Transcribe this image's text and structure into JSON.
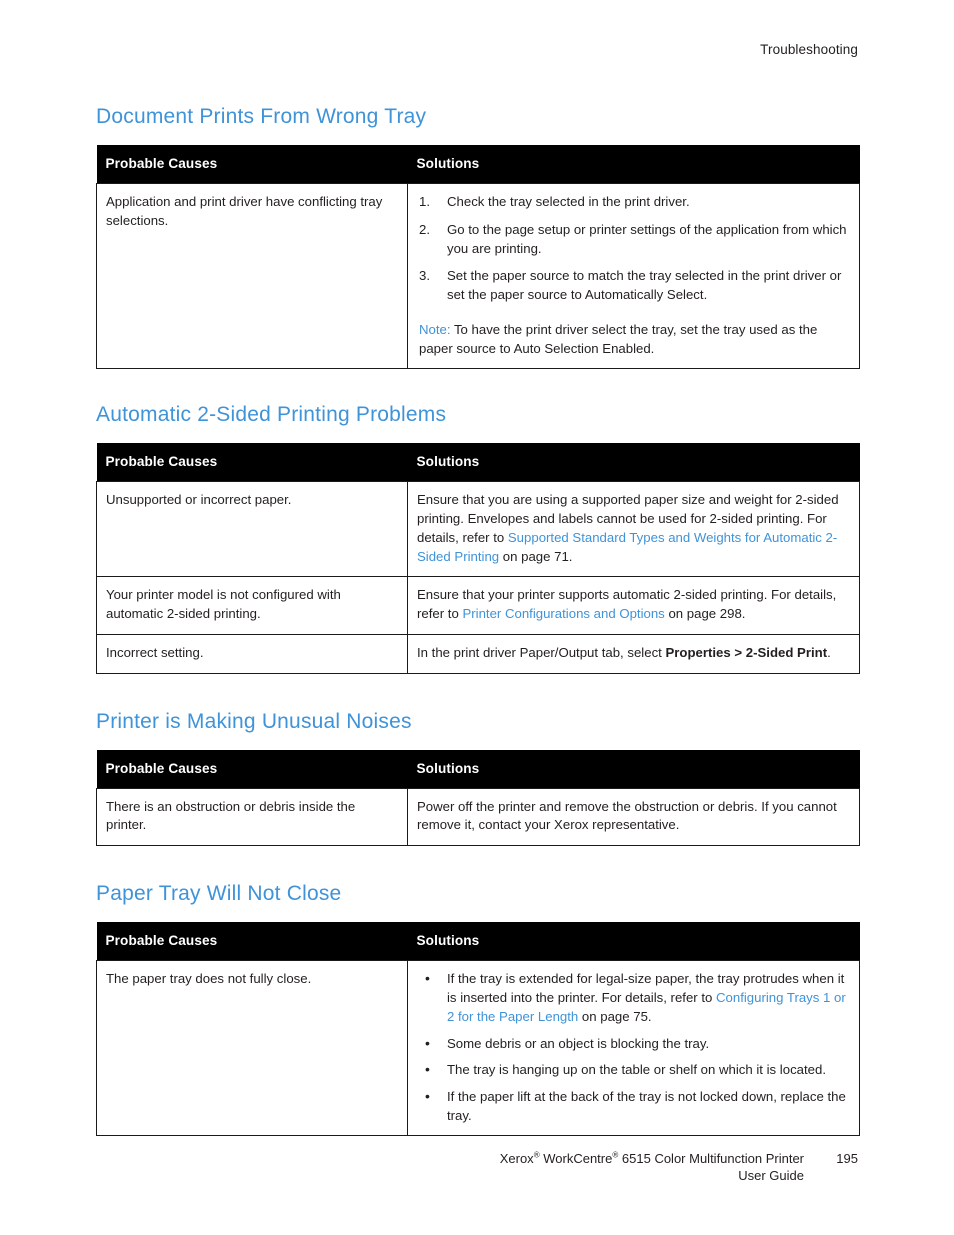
{
  "header": {
    "running_head": "Troubleshooting"
  },
  "table_headers": {
    "causes": "Probable Causes",
    "solutions": "Solutions"
  },
  "sections": [
    {
      "heading": "Document Prints From Wrong Tray",
      "rows": [
        {
          "cause": "Application and print driver have conflicting tray selections.",
          "solution_type": "ordered",
          "items": [
            "Check the tray selected in the print driver.",
            "Go to the page setup or printer settings of the application from which you are printing.",
            "Set the paper source to match the tray selected in the print driver or set the paper source to Automatically Select."
          ],
          "note_label": "Note:",
          "note_text": " To have the print driver select the tray, set the tray used as the paper source to Auto Selection Enabled."
        }
      ]
    },
    {
      "heading": "Automatic 2-Sided Printing Problems",
      "rows": [
        {
          "cause": "Unsupported or incorrect paper.",
          "solution_type": "rich",
          "parts": [
            {
              "text": "Ensure that you are using a supported paper size and weight for 2-sided printing. Envelopes and labels cannot be used for 2-sided printing. For details, refer to ",
              "style": "plain"
            },
            {
              "text": "Supported Standard Types and Weights for Automatic 2-Sided Printing",
              "style": "link"
            },
            {
              "text": " on page 71.",
              "style": "plain"
            }
          ]
        },
        {
          "cause": "Your printer model is not configured with automatic 2-sided printing.",
          "solution_type": "rich",
          "parts": [
            {
              "text": "Ensure that your printer supports automatic 2-sided printing. For details, refer to ",
              "style": "plain"
            },
            {
              "text": "Printer Configurations and Options",
              "style": "link"
            },
            {
              "text": " on page 298.",
              "style": "plain"
            }
          ]
        },
        {
          "cause": "Incorrect setting.",
          "solution_type": "rich",
          "parts": [
            {
              "text": "In the print driver Paper/Output tab, select ",
              "style": "plain"
            },
            {
              "text": "Properties > 2-Sided Print",
              "style": "bold"
            },
            {
              "text": ".",
              "style": "plain"
            }
          ]
        }
      ]
    },
    {
      "heading": "Printer is Making Unusual Noises",
      "rows": [
        {
          "cause": "There is an obstruction or debris inside the printer.",
          "solution_type": "rich",
          "parts": [
            {
              "text": "Power off the printer and remove the obstruction or debris. If you cannot remove it, contact your Xerox representative.",
              "style": "plain"
            }
          ]
        }
      ]
    },
    {
      "heading": "Paper Tray Will Not Close",
      "rows": [
        {
          "cause": "The paper tray does not fully close.",
          "solution_type": "bulleted",
          "bullets": [
            {
              "parts": [
                {
                  "text": "If the tray is extended for legal-size paper, the tray protrudes when it is inserted into the printer. For details, refer to ",
                  "style": "plain"
                },
                {
                  "text": "Configuring Trays 1 or 2 for the Paper Length",
                  "style": "link"
                },
                {
                  "text": " on page 75.",
                  "style": "plain"
                }
              ]
            },
            {
              "parts": [
                {
                  "text": "Some debris or an object is blocking the tray.",
                  "style": "plain"
                }
              ]
            },
            {
              "parts": [
                {
                  "text": "The tray is hanging up on the table or shelf on which it is located.",
                  "style": "plain"
                }
              ]
            },
            {
              "parts": [
                {
                  "text": "If the paper lift at the back of the tray is not locked down, replace the tray.",
                  "style": "plain"
                }
              ]
            }
          ]
        }
      ]
    }
  ],
  "footer": {
    "product_pre": "Xerox",
    "product_mid": " WorkCentre",
    "product_post": " 6515 Color Multifunction Printer",
    "registered_mark": "®",
    "guide_label": "User Guide",
    "page_number": "195"
  },
  "colors": {
    "heading_blue": "#3f93d8",
    "link_blue": "#3f93d8",
    "table_header_bg": "#000000",
    "body_text": "#231f20"
  }
}
